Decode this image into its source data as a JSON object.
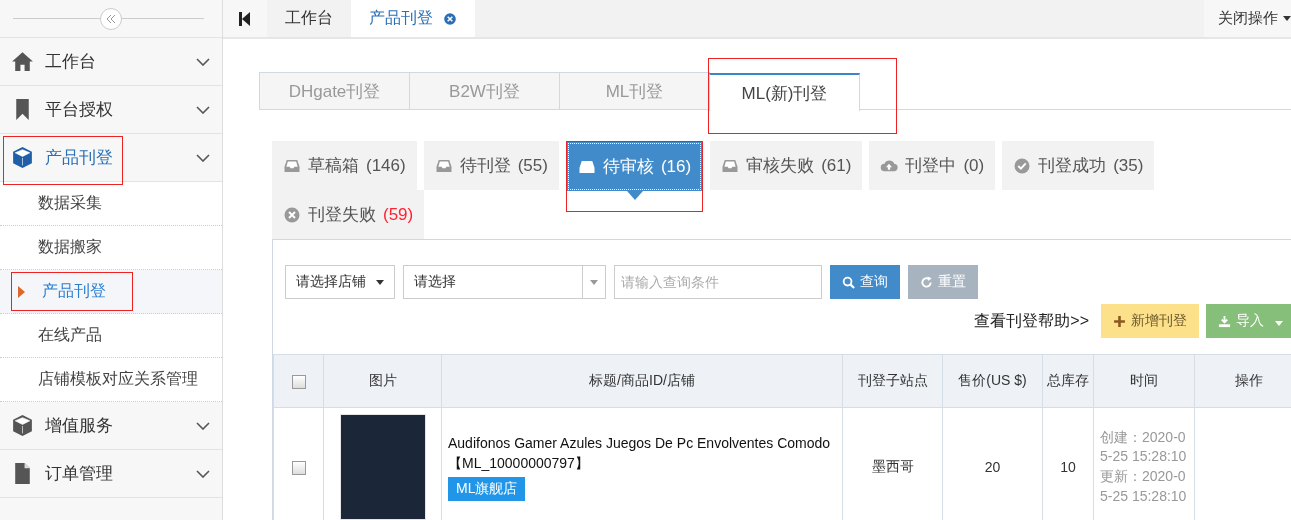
{
  "sidebar": {
    "menu": [
      {
        "label": "工作台",
        "selected": false,
        "annotated": false
      },
      {
        "label": "平台授权",
        "selected": false,
        "annotated": false
      },
      {
        "label": "产品刊登",
        "selected": true,
        "annotated": true,
        "children": [
          {
            "label": "数据采集",
            "selected": false,
            "annotated": false
          },
          {
            "label": "数据搬家",
            "selected": false,
            "annotated": false
          },
          {
            "label": "产品刊登",
            "selected": true,
            "annotated": true
          },
          {
            "label": "在线产品",
            "selected": false,
            "annotated": false
          },
          {
            "label": "店铺模板对应关系管理",
            "selected": false,
            "annotated": false
          }
        ]
      },
      {
        "label": "增值服务",
        "selected": false,
        "annotated": false
      },
      {
        "label": "订单管理",
        "selected": false,
        "annotated": false
      }
    ]
  },
  "top_tabs": [
    {
      "label": "工作台",
      "selected": false,
      "closable": false
    },
    {
      "label": "产品刊登",
      "selected": true,
      "closable": true
    }
  ],
  "close_menu": "关闭操作",
  "platform_tabs": [
    {
      "label": "DHgate刊登",
      "selected": false,
      "annotated": false
    },
    {
      "label": "B2W刊登",
      "selected": false,
      "annotated": false
    },
    {
      "label": "ML刊登",
      "selected": false,
      "annotated": false
    },
    {
      "label": "ML(新)刊登",
      "selected": true,
      "annotated": true
    }
  ],
  "status_tabs": [
    {
      "label": "草稿箱",
      "count": "(146)",
      "selected": false,
      "alert": false,
      "annotated": false
    },
    {
      "label": "待刊登",
      "count": "(55)",
      "selected": false,
      "alert": false,
      "annotated": false
    },
    {
      "label": "待审核",
      "count": "(16)",
      "selected": true,
      "alert": false,
      "annotated": true
    },
    {
      "label": "审核失败",
      "count": "(61)",
      "selected": false,
      "alert": false,
      "annotated": false
    },
    {
      "label": "刊登中",
      "count": "(0)",
      "selected": false,
      "alert": false,
      "annotated": false
    },
    {
      "label": "刊登成功",
      "count": "(35)",
      "selected": false,
      "alert": false,
      "annotated": false
    },
    {
      "label": "刊登失败",
      "count": "(59)",
      "selected": false,
      "alert": true,
      "annotated": false
    }
  ],
  "filters": {
    "shop_select": "请选择店铺",
    "select": "请选择",
    "query_placeholder": "请输入查询条件",
    "search_button": "查询",
    "reset_button": "重置",
    "help_link": "查看刊登帮助>>",
    "add_button": "新增刊登",
    "import_button": "导入"
  },
  "table": {
    "header_checked": false,
    "columns": [
      "图片",
      "标题/商品ID/店铺",
      "刊登子站点",
      "售价(US $)",
      "总库存",
      "时间",
      "操作"
    ],
    "rows": [
      {
        "checked": false,
        "title": "Audifonos Gamer Azules Juegos De Pc Envolventes Comodo",
        "product_id": "【ML_10000000797】",
        "shop": "ML旗舰店",
        "site": "墨西哥",
        "price": "20",
        "stock": "10",
        "created": "创建：2020-05-25 15:28:10",
        "updated": "更新：2020-05-25 15:28:10"
      }
    ]
  }
}
